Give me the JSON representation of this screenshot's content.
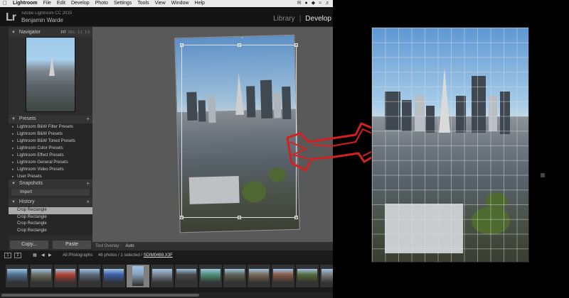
{
  "menubar": {
    "app_name": "Lightroom",
    "items": [
      "File",
      "Edit",
      "Develop",
      "Photo",
      "Settings",
      "Tools",
      "View",
      "Window",
      "Help"
    ]
  },
  "identity": {
    "logo": "Lr",
    "product": "Adobe Lightroom CC 2015",
    "user": "Benjamin Warde"
  },
  "modules": {
    "library": "Library",
    "separator": "|",
    "develop": "Develop",
    "active": "Develop"
  },
  "navigator": {
    "title": "Navigator",
    "options": [
      "FIT",
      "FILL",
      "1:1",
      "1:3"
    ]
  },
  "presets": {
    "title": "Presets",
    "items": [
      "Lightroom B&W Filter Presets",
      "Lightroom B&W Presets",
      "Lightroom B&W Toned Presets",
      "Lightroom Color Presets",
      "Lightroom Effect Presets",
      "Lightroom General Presets",
      "Lightroom Video Presets",
      "User Presets"
    ]
  },
  "snapshots": {
    "title": "Snapshots",
    "items": [
      "Import"
    ]
  },
  "history": {
    "title": "History",
    "items": [
      "Crop Rectangle",
      "Crop Rectangle",
      "Crop Rectangle",
      "Crop Rectangle"
    ],
    "selected_index": 0
  },
  "buttons": {
    "copy": "Copy...",
    "paste": "Paste"
  },
  "toolbar": {
    "overlay_label": "Tool Overlay :",
    "overlay_value": "Auto"
  },
  "filmstrip": {
    "view_1": "1",
    "view_2": "2",
    "source": "All Photographs",
    "count": "46 photos / 1 selected /",
    "filename": "SDIM0469.X3F",
    "thumb_colors": [
      "#4f6e8d",
      "#6d6d60",
      "#b2412e",
      "#5d6a78",
      "#3b5fa6",
      "#8aa3bd",
      "#7b8593",
      "#4a4a4a",
      "#4f8e74",
      "#5e6352",
      "#7a6a55",
      "#8a5a45",
      "#566a3a",
      "#7b7b7b"
    ],
    "selected_index": 5
  },
  "colors": {
    "arrow": "#d42020",
    "selected_history": "#aaaaaa"
  }
}
